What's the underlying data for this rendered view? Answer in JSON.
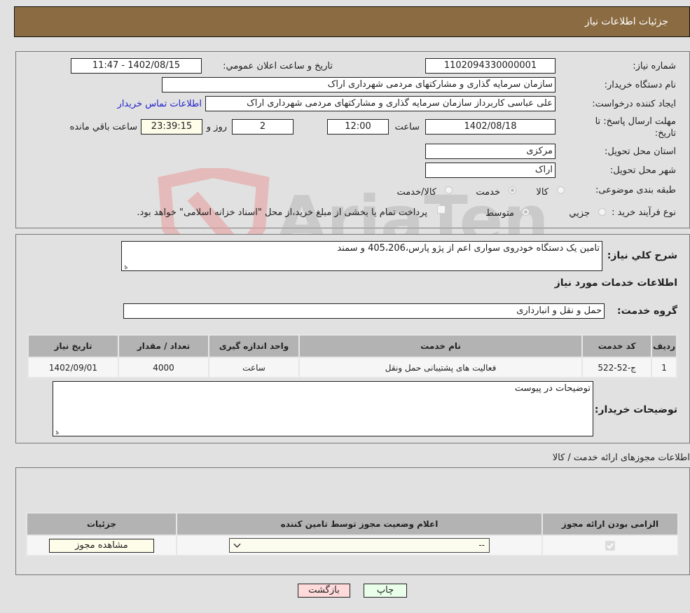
{
  "header": {
    "title": "جزئیات اطلاعات نیاز"
  },
  "need_info": {
    "need_number_label": "شماره نیاز:",
    "need_number": "1102094330000001",
    "announce_label": "تاریخ و ساعت اعلان عمومي:",
    "announce_value": "1402/08/15 - 11:47",
    "buyer_org_label": "نام دستگاه خریدار:",
    "buyer_org": "سازمان سرمایه گذاری و مشارکتهای مردمی شهرداری اراک",
    "requester_label": "ایجاد کننده درخواست:",
    "requester": "علی عباسی کاربرداز سازمان سرمایه گذاری و مشارکتهای مردمی شهرداری اراک",
    "contact_link": "اطلاعات تماس خریدار",
    "deadline_label": "مهلت ارسال پاسخ: تا تاریخ:",
    "deadline_date": "1402/08/18",
    "time_label": "ساعت",
    "deadline_time": "12:00",
    "days_value": "2",
    "days_label": "روز و",
    "remaining_time": "23:39:15",
    "remaining_label": "ساعت باقي مانده",
    "province_label": "استان محل تحویل:",
    "province": "مرکزی",
    "city_label": "شهر محل تحویل:",
    "city": "اراک",
    "category_label": "طبقه بندی موضوعی:",
    "category_options": [
      {
        "label": "کالا",
        "checked": false
      },
      {
        "label": "خدمت",
        "checked": true
      },
      {
        "label": "کالا/خدمت",
        "checked": false
      }
    ],
    "process_label": "نوع فرآیند خرید :",
    "process_options": [
      {
        "label": "جزيي",
        "checked": false
      },
      {
        "label": "متوسط",
        "checked": true
      }
    ],
    "treasury_note": "پرداخت تمام یا بخشی از مبلغ خرید،از محل \"اسناد خزانه اسلامی\" خواهد بود."
  },
  "description": {
    "label": "شرح کلي نياز:",
    "value": "تامین یک دستگاه خودروی سواری اعم از پژو پارس،405،206 و سمند"
  },
  "services": {
    "section_title": "اطلاعات خدمات مورد نياز",
    "group_label": "گروه خدمت:",
    "group_value": "حمل و نقل و انبارداری",
    "table": {
      "headers": [
        "ردیف",
        "کد خدمت",
        "نام خدمت",
        "واحد اندازه گیری",
        "تعداد / مقدار",
        "تاریخ نیاز"
      ],
      "rows": [
        [
          "1",
          "ج-52-522",
          "فعالیت های پشتیبانی حمل ونقل",
          "ساعت",
          "4000",
          "1402/09/01"
        ]
      ]
    },
    "buyer_notes_label": "توضيحات خريدار:",
    "buyer_notes": "توضیحات در پیوست"
  },
  "permits": {
    "section_title": "اطلاعات مجوزهای ارائه خدمت / کالا",
    "headers": [
      "الزامی بودن ارائه مجوز",
      "اعلام وضعیت مجوز توسط تامین کننده",
      "جزئیات"
    ],
    "row": {
      "required_checked": true,
      "status_selected": "--",
      "details_button": "مشاهده مجوز"
    }
  },
  "footer": {
    "print_button": "چاپ",
    "back_button": "بازگشت"
  },
  "colors": {
    "header_bg": "#8b6c42",
    "back_button_bg": "#ffdada",
    "print_button_bg": "#eaffea",
    "link": "#2222cc"
  }
}
